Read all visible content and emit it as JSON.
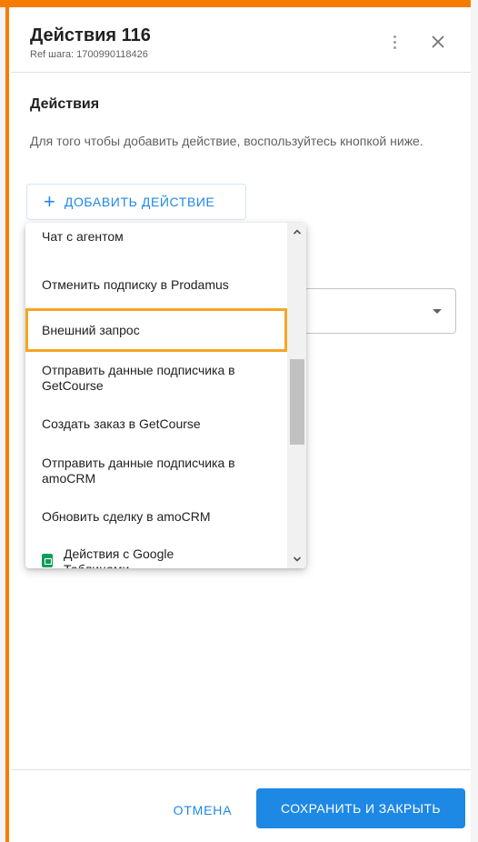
{
  "header": {
    "title": "Действия 116",
    "subtitle": "Ref шага: 1700990118426"
  },
  "section": {
    "title": "Действия",
    "description": "Для того чтобы добавить действие, воспользуйтесь кнопкой ниже."
  },
  "add_button": {
    "icon": "+",
    "label": "ДОБАВИТЬ ДЕЙСТВИЕ"
  },
  "dropdown": {
    "items": [
      {
        "label": "Чат с агентом"
      },
      {
        "label": "Отменить подписку в Prodamus"
      },
      {
        "label": "Внешний запрос",
        "highlighted": true
      },
      {
        "label": "Отправить данные подписчика в GetCourse"
      },
      {
        "label": "Создать заказ в GetCourse"
      },
      {
        "label": "Отправить данные подписчика в amoCRM"
      },
      {
        "label": "Обновить сделку в amoCRM"
      },
      {
        "label": "Действия с Google Таблицами",
        "icon": "google-sheets-icon"
      }
    ]
  },
  "footer": {
    "cancel_label": "ОТМЕНА",
    "save_label": "СОХРАНИТЬ И ЗАКРЫТЬ"
  },
  "colors": {
    "accent": "#1e88e5",
    "frame": "#f57c00",
    "highlight": "#f5a623",
    "sheets": "#0f9d58"
  }
}
